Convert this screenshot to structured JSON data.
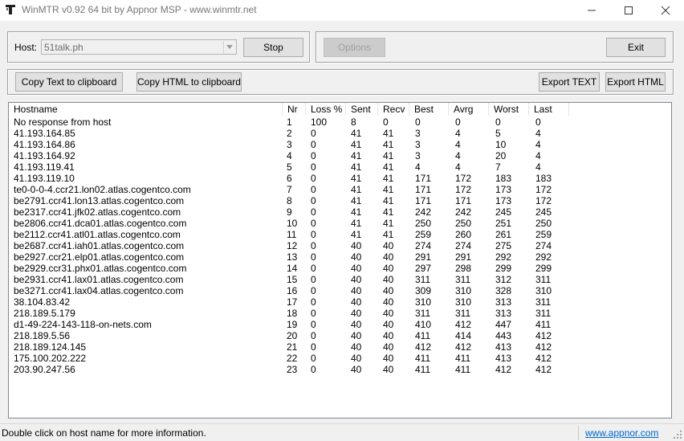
{
  "window": {
    "title": "WinMTR v0.92 64 bit by Appnor MSP - www.winmtr.net"
  },
  "toolbar": {
    "host_label": "Host:",
    "host_value": "51talk.ph",
    "stop_label": "Stop",
    "options_label": "Options",
    "exit_label": "Exit",
    "copy_text_label": "Copy Text to clipboard",
    "copy_html_label": "Copy HTML to clipboard",
    "export_text_label": "Export TEXT",
    "export_html_label": "Export HTML"
  },
  "table": {
    "columns": [
      "Hostname",
      "Nr",
      "Loss %",
      "Sent",
      "Recv",
      "Best",
      "Avrg",
      "Worst",
      "Last"
    ],
    "rows": [
      [
        "No response from host",
        "1",
        "100",
        "8",
        "0",
        "0",
        "0",
        "0",
        "0"
      ],
      [
        "41.193.164.85",
        "2",
        "0",
        "41",
        "41",
        "3",
        "4",
        "5",
        "4"
      ],
      [
        "41.193.164.86",
        "3",
        "0",
        "41",
        "41",
        "3",
        "4",
        "10",
        "4"
      ],
      [
        "41.193.164.92",
        "4",
        "0",
        "41",
        "41",
        "3",
        "4",
        "20",
        "4"
      ],
      [
        "41.193.119.41",
        "5",
        "0",
        "41",
        "41",
        "4",
        "4",
        "7",
        "4"
      ],
      [
        "41.193.119.10",
        "6",
        "0",
        "41",
        "41",
        "171",
        "172",
        "183",
        "183"
      ],
      [
        "te0-0-0-4.ccr21.lon02.atlas.cogentco.com",
        "7",
        "0",
        "41",
        "41",
        "171",
        "172",
        "173",
        "172"
      ],
      [
        "be2791.ccr41.lon13.atlas.cogentco.com",
        "8",
        "0",
        "41",
        "41",
        "171",
        "171",
        "173",
        "172"
      ],
      [
        "be2317.ccr41.jfk02.atlas.cogentco.com",
        "9",
        "0",
        "41",
        "41",
        "242",
        "242",
        "245",
        "245"
      ],
      [
        "be2806.ccr41.dca01.atlas.cogentco.com",
        "10",
        "0",
        "41",
        "41",
        "250",
        "250",
        "251",
        "250"
      ],
      [
        "be2112.ccr41.atl01.atlas.cogentco.com",
        "11",
        "0",
        "41",
        "41",
        "259",
        "260",
        "261",
        "259"
      ],
      [
        "be2687.ccr41.iah01.atlas.cogentco.com",
        "12",
        "0",
        "40",
        "40",
        "274",
        "274",
        "275",
        "274"
      ],
      [
        "be2927.ccr21.elp01.atlas.cogentco.com",
        "13",
        "0",
        "40",
        "40",
        "291",
        "291",
        "292",
        "292"
      ],
      [
        "be2929.ccr31.phx01.atlas.cogentco.com",
        "14",
        "0",
        "40",
        "40",
        "297",
        "298",
        "299",
        "299"
      ],
      [
        "be2931.ccr41.lax01.atlas.cogentco.com",
        "15",
        "0",
        "40",
        "40",
        "311",
        "311",
        "312",
        "311"
      ],
      [
        "be3271.ccr41.lax04.atlas.cogentco.com",
        "16",
        "0",
        "40",
        "40",
        "309",
        "310",
        "328",
        "310"
      ],
      [
        "38.104.83.42",
        "17",
        "0",
        "40",
        "40",
        "310",
        "310",
        "313",
        "311"
      ],
      [
        "218.189.5.179",
        "18",
        "0",
        "40",
        "40",
        "311",
        "311",
        "313",
        "311"
      ],
      [
        "d1-49-224-143-118-on-nets.com",
        "19",
        "0",
        "40",
        "40",
        "410",
        "412",
        "447",
        "411"
      ],
      [
        "218.189.5.56",
        "20",
        "0",
        "40",
        "40",
        "411",
        "414",
        "443",
        "412"
      ],
      [
        "218.189.124.145",
        "21",
        "0",
        "40",
        "40",
        "412",
        "412",
        "413",
        "412"
      ],
      [
        "175.100.202.222",
        "22",
        "0",
        "40",
        "40",
        "411",
        "411",
        "413",
        "412"
      ],
      [
        "203.90.247.56",
        "23",
        "0",
        "40",
        "40",
        "411",
        "411",
        "412",
        "412"
      ]
    ]
  },
  "statusbar": {
    "message": "Double click on host name for more information.",
    "link": "www.appnor.com"
  }
}
